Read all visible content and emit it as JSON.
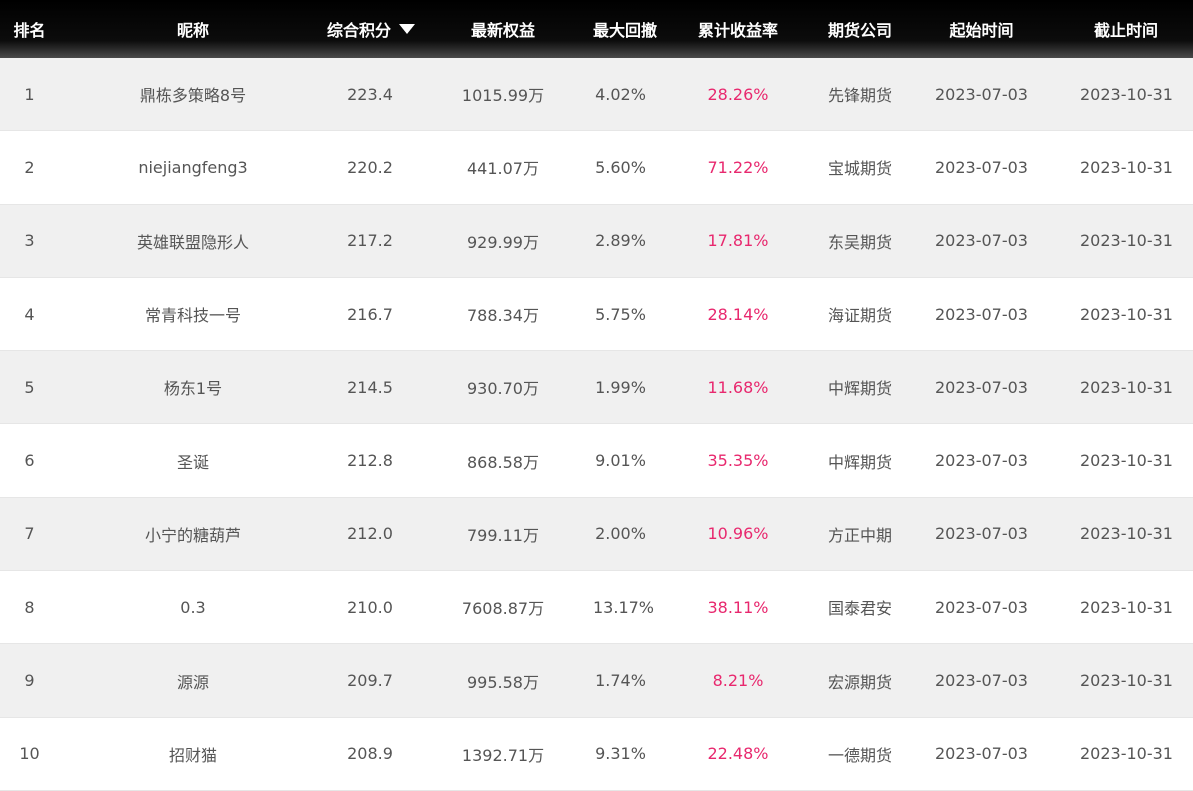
{
  "header": {
    "rank": "排名",
    "name": "昵称",
    "score": "综合积分",
    "equity": "最新权益",
    "max_drawdown": "最大回撤",
    "cum_return": "累计收益率",
    "firm": "期货公司",
    "start": "起始时间",
    "end": "截止时间"
  },
  "colors": {
    "header_bg": "#000000",
    "return_text": "#e8286e",
    "row_alt_bg": "#f0f0f0",
    "body_text": "#555555"
  },
  "rows": [
    {
      "rank": "1",
      "name": "鼎栋多策略8号",
      "score": "223.4",
      "equity": "1015.99万",
      "max_drawdown": "4.02%",
      "cum_return": "28.26%",
      "firm": "先锋期货",
      "start": "2023-07-03",
      "end": "2023-10-31"
    },
    {
      "rank": "2",
      "name": "niejiangfeng3",
      "score": "220.2",
      "equity": "441.07万",
      "max_drawdown": "5.60%",
      "cum_return": "71.22%",
      "firm": "宝城期货",
      "start": "2023-07-03",
      "end": "2023-10-31"
    },
    {
      "rank": "3",
      "name": "英雄联盟隐形人",
      "score": "217.2",
      "equity": "929.99万",
      "max_drawdown": "2.89%",
      "cum_return": "17.81%",
      "firm": "东吴期货",
      "start": "2023-07-03",
      "end": "2023-10-31"
    },
    {
      "rank": "4",
      "name": "常青科技一号",
      "score": "216.7",
      "equity": "788.34万",
      "max_drawdown": "5.75%",
      "cum_return": "28.14%",
      "firm": "海证期货",
      "start": "2023-07-03",
      "end": "2023-10-31"
    },
    {
      "rank": "5",
      "name": "杨东1号",
      "score": "214.5",
      "equity": "930.70万",
      "max_drawdown": "1.99%",
      "cum_return": "11.68%",
      "firm": "中辉期货",
      "start": "2023-07-03",
      "end": "2023-10-31"
    },
    {
      "rank": "6",
      "name": "圣诞",
      "score": "212.8",
      "equity": "868.58万",
      "max_drawdown": "9.01%",
      "cum_return": "35.35%",
      "firm": "中辉期货",
      "start": "2023-07-03",
      "end": "2023-10-31"
    },
    {
      "rank": "7",
      "name": "小宁的糖葫芦",
      "score": "212.0",
      "equity": "799.11万",
      "max_drawdown": "2.00%",
      "cum_return": "10.96%",
      "firm": "方正中期",
      "start": "2023-07-03",
      "end": "2023-10-31"
    },
    {
      "rank": "8",
      "name": "0.3",
      "score": "210.0",
      "equity": "7608.87万",
      "max_drawdown": "13.17%",
      "cum_return": "38.11%",
      "firm": "国泰君安",
      "start": "2023-07-03",
      "end": "2023-10-31"
    },
    {
      "rank": "9",
      "name": "源源",
      "score": "209.7",
      "equity": "995.58万",
      "max_drawdown": "1.74%",
      "cum_return": "8.21%",
      "firm": "宏源期货",
      "start": "2023-07-03",
      "end": "2023-10-31"
    },
    {
      "rank": "10",
      "name": "招财猫",
      "score": "208.9",
      "equity": "1392.71万",
      "max_drawdown": "9.31%",
      "cum_return": "22.48%",
      "firm": "一德期货",
      "start": "2023-07-03",
      "end": "2023-10-31"
    }
  ]
}
